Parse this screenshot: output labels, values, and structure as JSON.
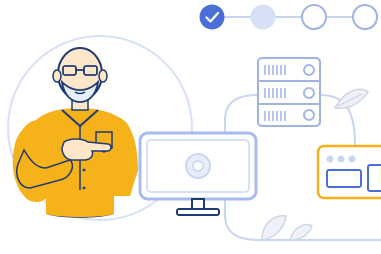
{
  "stepper": {
    "steps": [
      {
        "state": "completed",
        "icon": "check-icon"
      },
      {
        "state": "current"
      },
      {
        "state": "upcoming"
      },
      {
        "state": "upcoming"
      }
    ]
  },
  "colors": {
    "accent": "#4a6fd8",
    "completed_fill": "#4a6fd8",
    "current_fill": "#d6e0f7",
    "outline": "#9fb3e6",
    "shirt": "#f6b21b",
    "skin": "#fde7c8",
    "line": "#c9d6f2",
    "leaf": "#e9edf5",
    "screen_frame": "#a8bbf0",
    "dark_stroke": "#1f3b73"
  },
  "illustration": {
    "subject": "person-pointing-at-monitor",
    "elements": [
      "server-stack-icon",
      "computer-monitor-icon",
      "router-device-icon",
      "leaf-decoration-icon"
    ]
  }
}
